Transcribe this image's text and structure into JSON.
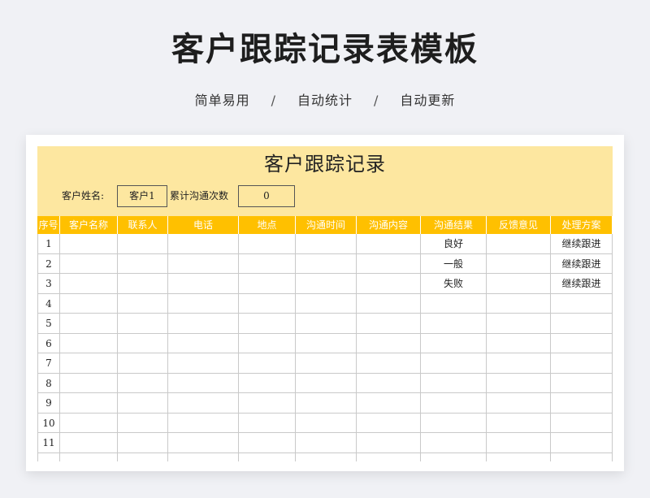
{
  "page": {
    "title": "客户跟踪记录表模板",
    "features": [
      "简单易用",
      "自动统计",
      "自动更新"
    ],
    "separator": "/"
  },
  "sheet": {
    "title": "客户跟踪记录",
    "customer_name_label": "客户姓名:",
    "customer_name_value": "客户1",
    "count_label": "累计沟通次数",
    "count_value": "0",
    "columns": [
      "序号",
      "客户名称",
      "联系人",
      "电话",
      "地点",
      "沟通时间",
      "沟通内容",
      "沟通结果",
      "反馈意见",
      "处理方案"
    ],
    "rows": [
      [
        "1",
        "",
        "",
        "",
        "",
        "",
        "",
        "良好",
        "",
        "继续跟进"
      ],
      [
        "2",
        "",
        "",
        "",
        "",
        "",
        "",
        "一般",
        "",
        "继续跟进"
      ],
      [
        "3",
        "",
        "",
        "",
        "",
        "",
        "",
        "失败",
        "",
        "继续跟进"
      ],
      [
        "4",
        "",
        "",
        "",
        "",
        "",
        "",
        "",
        "",
        ""
      ],
      [
        "5",
        "",
        "",
        "",
        "",
        "",
        "",
        "",
        "",
        ""
      ],
      [
        "6",
        "",
        "",
        "",
        "",
        "",
        "",
        "",
        "",
        ""
      ],
      [
        "7",
        "",
        "",
        "",
        "",
        "",
        "",
        "",
        "",
        ""
      ],
      [
        "8",
        "",
        "",
        "",
        "",
        "",
        "",
        "",
        "",
        ""
      ],
      [
        "9",
        "",
        "",
        "",
        "",
        "",
        "",
        "",
        "",
        ""
      ],
      [
        "10",
        "",
        "",
        "",
        "",
        "",
        "",
        "",
        "",
        ""
      ],
      [
        "11",
        "",
        "",
        "",
        "",
        "",
        "",
        "",
        "",
        ""
      ],
      [
        "",
        "",
        "",
        "",
        "",
        "",
        "",
        "",
        "",
        ""
      ]
    ]
  },
  "colors": {
    "header_band": "#fde7a0",
    "column_header": "#ffc000",
    "grid_line": "#c9c9c9",
    "background": "#f0f1f5"
  }
}
